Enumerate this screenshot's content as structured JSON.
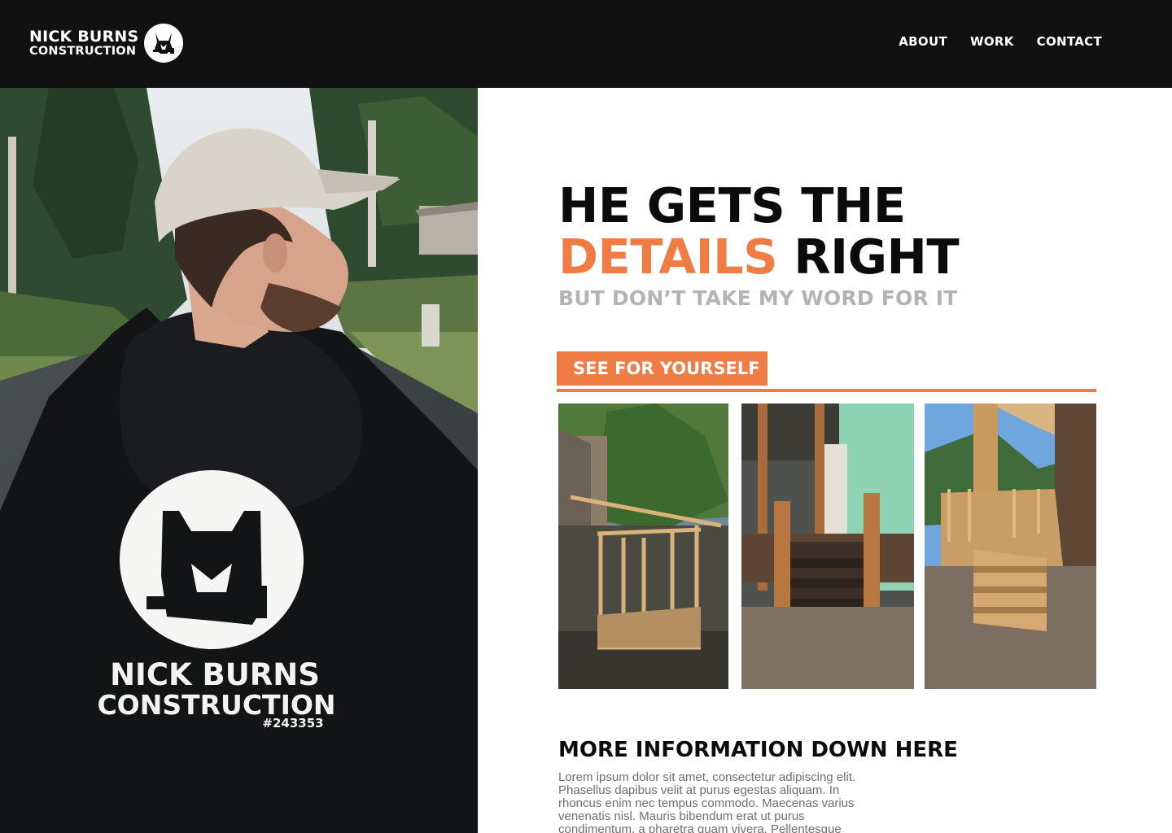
{
  "header": {
    "brand_line1": "NICK BURNS",
    "brand_line2": "CONSTRUCTION",
    "logo_icon": "husky-hammer-logo",
    "nav": [
      "ABOUT",
      "WORK",
      "CONTACT"
    ]
  },
  "hero": {
    "title_line1": "HE GETS THE",
    "title_accent": "DETAILS",
    "title_rest": " RIGHT",
    "subtitle": "BUT DON’T TAKE MY WORD FOR IT",
    "cta_label": "SEE FOR YOURSELF"
  },
  "photo": {
    "hoodie_line1": "NICK BURNS",
    "hoodie_line2": "CONSTRUCTION",
    "hoodie_license": "#243353"
  },
  "gallery": {
    "images": [
      "shed-framing-photo",
      "porch-stairs-photo",
      "deck-stairs-photo"
    ]
  },
  "more": {
    "title": "MORE INFORMATION DOWN HERE",
    "body": "Lorem ipsum dolor sit amet, consectetur adipiscing elit. Phasellus dapibus velit at purus egestas aliquam. In rhoncus enim nec tempus commodo. Maecenas varius venenatis nisl. Mauris bibendum erat ut purus condimentum, a pharetra quam vivera. Pellentesque"
  },
  "colors": {
    "accent": "#ef7c45",
    "header_bg": "#111111",
    "subtitle": "#b4b4b4"
  }
}
